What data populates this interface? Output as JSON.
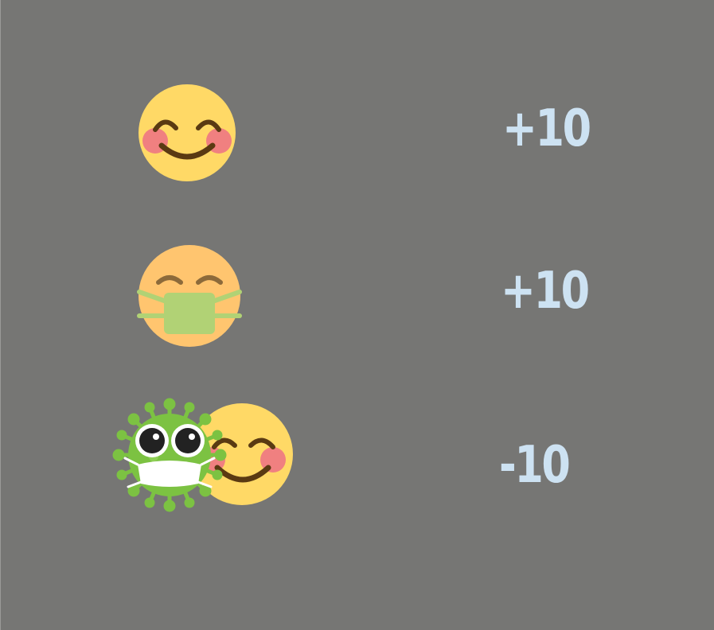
{
  "rules": [
    {
      "icon": "smiling-face-icon",
      "score": "+10"
    },
    {
      "icon": "masked-face-icon",
      "score": "+10"
    },
    {
      "icon": "virus-near-face-icon",
      "score": "-10"
    }
  ],
  "colors": {
    "background": "#767674",
    "score_text": "#cde2f2",
    "face_yellow": "#ffd966",
    "face_orange": "#ffc56f",
    "blush": "#f08080",
    "mask_green": "#b1d275",
    "virus_green": "#7cc242"
  }
}
